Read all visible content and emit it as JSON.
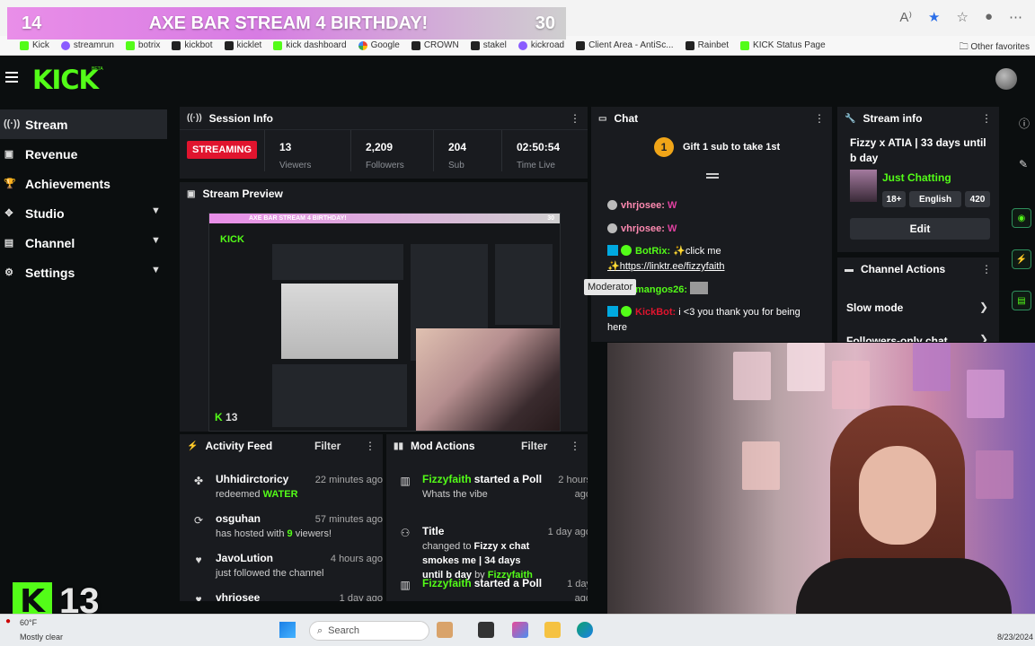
{
  "overlay": {
    "left_num": "14",
    "title": "AXE BAR STREAM 4 BIRTHDAY!",
    "right_num": "30"
  },
  "bookmarks": [
    "Kick",
    "streamrun",
    "botrix",
    "kickbot",
    "kicklet",
    "kick dashboard",
    "Google",
    "CROWN",
    "stakel",
    "kickroad",
    "Client Area - AntiSc...",
    "Rainbet",
    "KICK Status Page"
  ],
  "bookmarks_other": "Other favorites",
  "logo": {
    "text": "KICK",
    "beta": "BETA"
  },
  "sidebar": [
    {
      "label": "Stream",
      "icon": "((·))"
    },
    {
      "label": "Revenue",
      "icon": "▣"
    },
    {
      "label": "Achievements",
      "icon": "🏆"
    },
    {
      "label": "Studio",
      "icon": "✥"
    },
    {
      "label": "Channel",
      "icon": "▤"
    },
    {
      "label": "Settings",
      "icon": "⚙"
    }
  ],
  "session": {
    "title": "Session Info",
    "status": "STREAMING",
    "stats": [
      {
        "value": "13",
        "label": "Viewers"
      },
      {
        "value": "2,209",
        "label": "Followers"
      },
      {
        "value": "204",
        "label": "Sub"
      },
      {
        "value": "02:50:54",
        "label": "Time Live"
      }
    ]
  },
  "preview": {
    "title": "Stream Preview",
    "banner": "AXE BAR STREAM 4 BIRTHDAY!",
    "banner_num": "30",
    "kick": "KICK",
    "viewers": "13"
  },
  "chat": {
    "title": "Chat",
    "gift_badge": "1",
    "gift_text": "Gift 1 sub to take 1st",
    "messages": [
      {
        "user": "vhrjosee:",
        "text": ""
      },
      {
        "user": "vhrjosee:",
        "text": ""
      },
      {
        "user": "BotRix:",
        "text": "✨click me",
        "link": "✨https://linktr.ee/fizzyfaith"
      },
      {
        "user": "mangos26:",
        "text": ""
      },
      {
        "user": "KickBot:",
        "text": "i <3 you thank you for being here"
      }
    ],
    "tooltip": "Moderator"
  },
  "stream_info": {
    "title": "Stream info",
    "stream_title": "Fizzy x ATIA | 33 days until b day",
    "category": "Just Chatting",
    "tags": [
      "18+",
      "English",
      "420"
    ],
    "edit": "Edit"
  },
  "channel_actions": {
    "title": "Channel Actions",
    "items": [
      "Slow mode",
      "Followers-only chat"
    ]
  },
  "activity": {
    "title": "Activity Feed",
    "filter": "Filter",
    "items": [
      {
        "user": "Uhhidirctoricy",
        "action": "redeemed",
        "highlight": "WATER",
        "tail": "",
        "time": "22 minutes ago"
      },
      {
        "user": "osguhan",
        "action": "has hosted with",
        "highlight": "9",
        "tail": "viewers!",
        "time": "57 minutes ago"
      },
      {
        "user": "JavoLution",
        "action": "just followed the channel",
        "highlight": "",
        "tail": "",
        "time": "4 hours ago"
      },
      {
        "user": "vhrjosee",
        "action": "",
        "highlight": "",
        "tail": "",
        "time": "1 day ago"
      }
    ]
  },
  "mod": {
    "title": "Mod Actions",
    "filter": "Filter",
    "items": [
      {
        "user": "Fizzyfaith",
        "action": "started a Poll",
        "detail": "Whats the vibe",
        "time": "2 hours ago"
      },
      {
        "user": "Title",
        "action": "changed to",
        "detail": "Fizzy x chat smokes me | 34 days until b day",
        "by": "by",
        "by_user": "Fizzyfaith",
        "time": "1 day ago"
      },
      {
        "user": "Fizzyfaith",
        "action": "started a Poll",
        "detail": "",
        "time": "1 day ago"
      }
    ]
  },
  "bottom_overlay": {
    "k": "K",
    "num": "13"
  },
  "taskbar": {
    "weather_temp": "60°F",
    "weather": "Mostly clear",
    "search": "Search",
    "date": "8/23/2024"
  }
}
